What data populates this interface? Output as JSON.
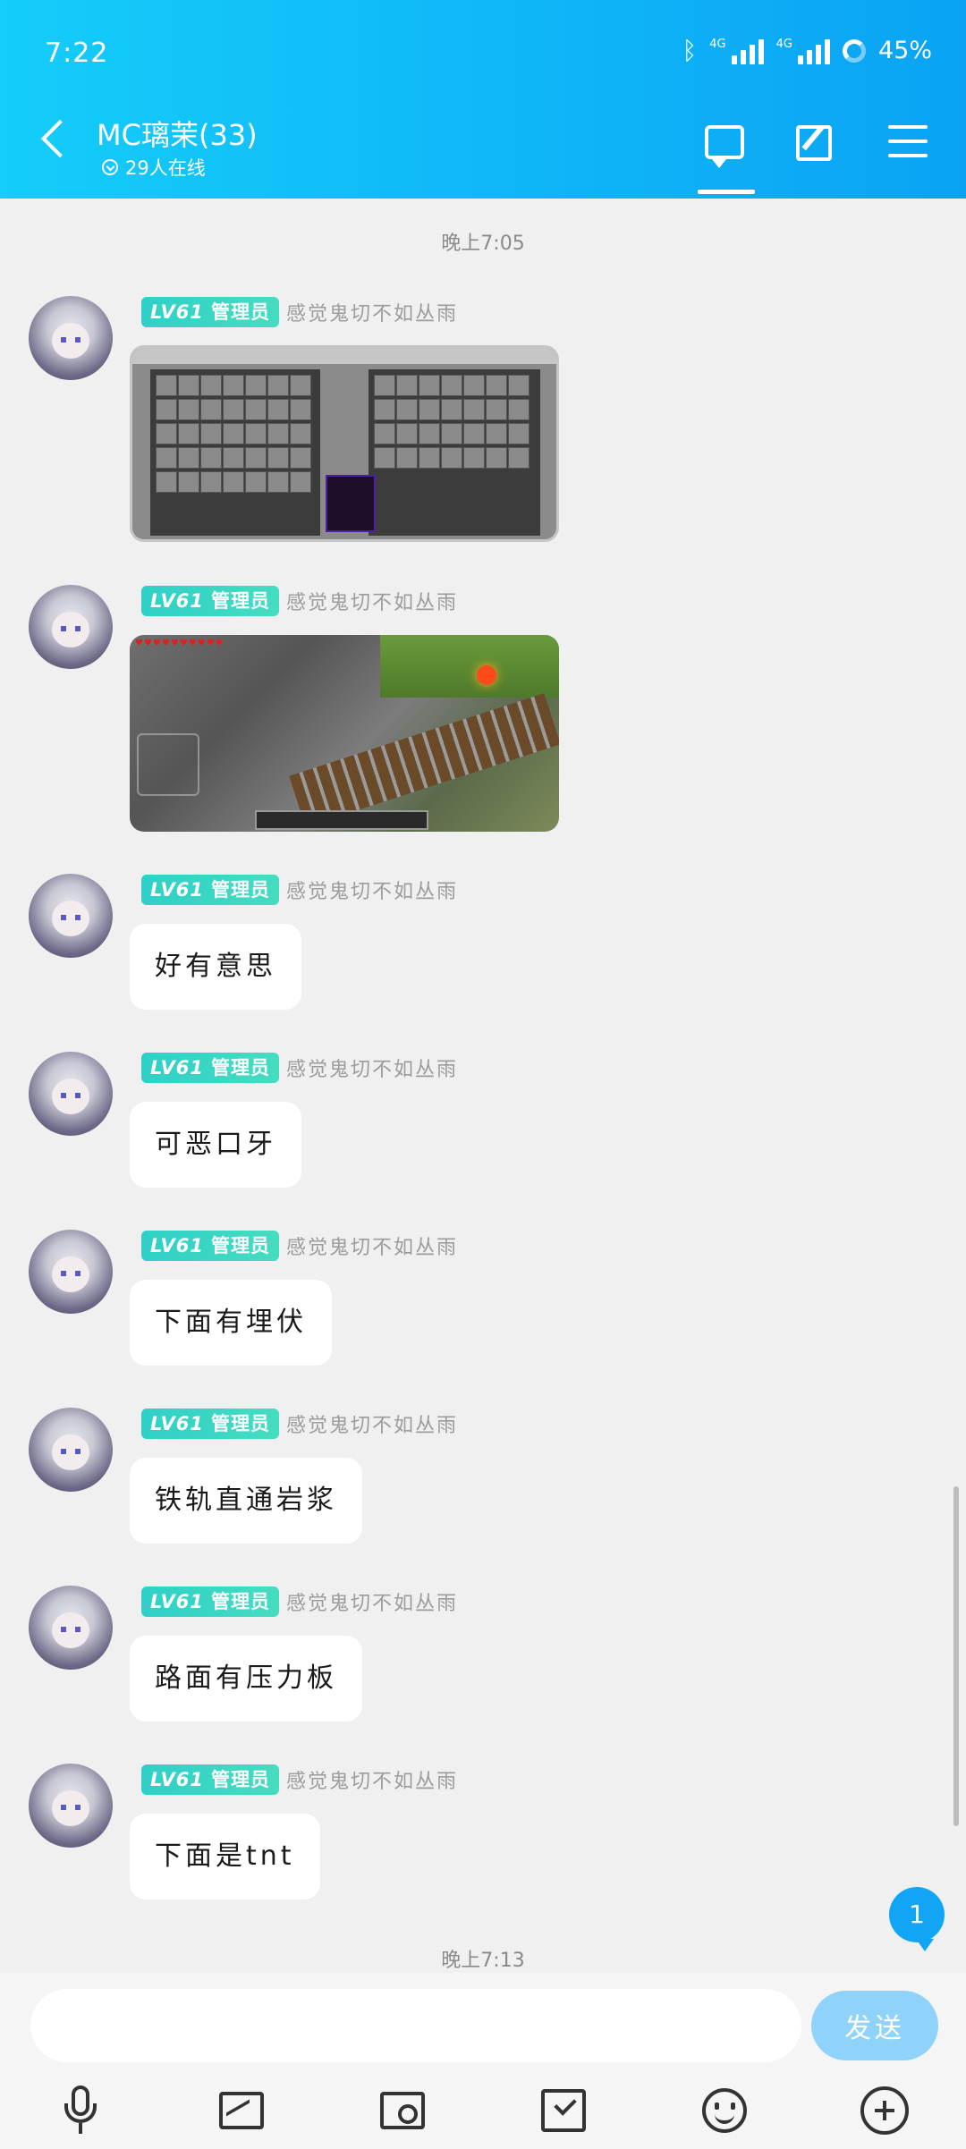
{
  "status_bar": {
    "time": "7:22",
    "network_a": "4G",
    "network_b": "4G",
    "battery": "45%"
  },
  "header": {
    "title": "MC璃茉(33)",
    "online": "29人在线"
  },
  "timestamps": [
    "晚上7:05",
    "晚上7:13"
  ],
  "messages": [
    {
      "level": "LV61",
      "role": "管理员",
      "sender": "感觉鬼切不如丛雨",
      "type": "image",
      "image": "inventory-screenshot"
    },
    {
      "level": "LV61",
      "role": "管理员",
      "sender": "感觉鬼切不如丛雨",
      "type": "image",
      "image": "game-screenshot"
    },
    {
      "level": "LV61",
      "role": "管理员",
      "sender": "感觉鬼切不如丛雨",
      "type": "text",
      "text": "好有意思"
    },
    {
      "level": "LV61",
      "role": "管理员",
      "sender": "感觉鬼切不如丛雨",
      "type": "text",
      "text": "可恶口牙"
    },
    {
      "level": "LV61",
      "role": "管理员",
      "sender": "感觉鬼切不如丛雨",
      "type": "text",
      "text": "下面有埋伏"
    },
    {
      "level": "LV61",
      "role": "管理员",
      "sender": "感觉鬼切不如丛雨",
      "type": "text",
      "text": "铁轨直通岩浆"
    },
    {
      "level": "LV61",
      "role": "管理员",
      "sender": "感觉鬼切不如丛雨",
      "type": "text",
      "text": "路面有压力板"
    },
    {
      "level": "LV61",
      "role": "管理员",
      "sender": "感觉鬼切不如丛雨",
      "type": "text",
      "text": "下面是tnt"
    }
  ],
  "unread_count": "1",
  "composer": {
    "placeholder": "",
    "send_label": "发送"
  },
  "toolbar_icons": [
    "microphone-icon",
    "image-icon",
    "camera-icon",
    "red-packet-icon",
    "emoji-icon",
    "plus-icon"
  ],
  "colors": {
    "header": "#0fb6f7",
    "badge": "#2fd0c8",
    "send": "#8fd3fb",
    "unread": "#12a5f5"
  }
}
